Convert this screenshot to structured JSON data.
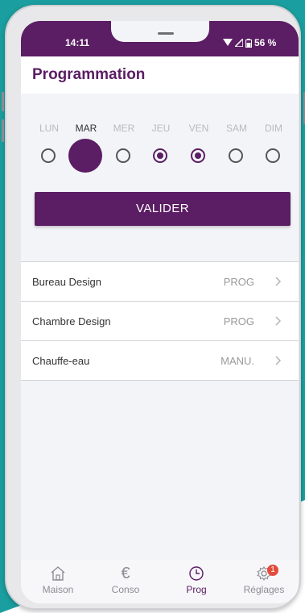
{
  "colors": {
    "primary": "#5b1d63",
    "teal": "#1a9e9f",
    "badge": "#e54b3d"
  },
  "status_bar": {
    "time": "14:11",
    "battery": "56 %"
  },
  "header": {
    "title": "Programmation"
  },
  "days": [
    {
      "label": "LUN",
      "state": "unchecked"
    },
    {
      "label": "MAR",
      "state": "today"
    },
    {
      "label": "MER",
      "state": "unchecked"
    },
    {
      "label": "JEU",
      "state": "checked"
    },
    {
      "label": "VEN",
      "state": "checked"
    },
    {
      "label": "SAM",
      "state": "unchecked"
    },
    {
      "label": "DIM",
      "state": "unchecked"
    }
  ],
  "validate_button": {
    "label": "VALIDER"
  },
  "devices": [
    {
      "name": "Bureau Design",
      "mode": "PROG"
    },
    {
      "name": "Chambre Design",
      "mode": "PROG"
    },
    {
      "name": "Chauffe-eau",
      "mode": "MANU."
    }
  ],
  "bottom_nav": [
    {
      "label": "Maison",
      "icon": "home-icon"
    },
    {
      "label": "Conso",
      "icon": "euro-icon"
    },
    {
      "label": "Prog",
      "icon": "clock-icon",
      "active": true
    },
    {
      "label": "Réglages",
      "icon": "gear-icon",
      "badge": "1"
    }
  ]
}
